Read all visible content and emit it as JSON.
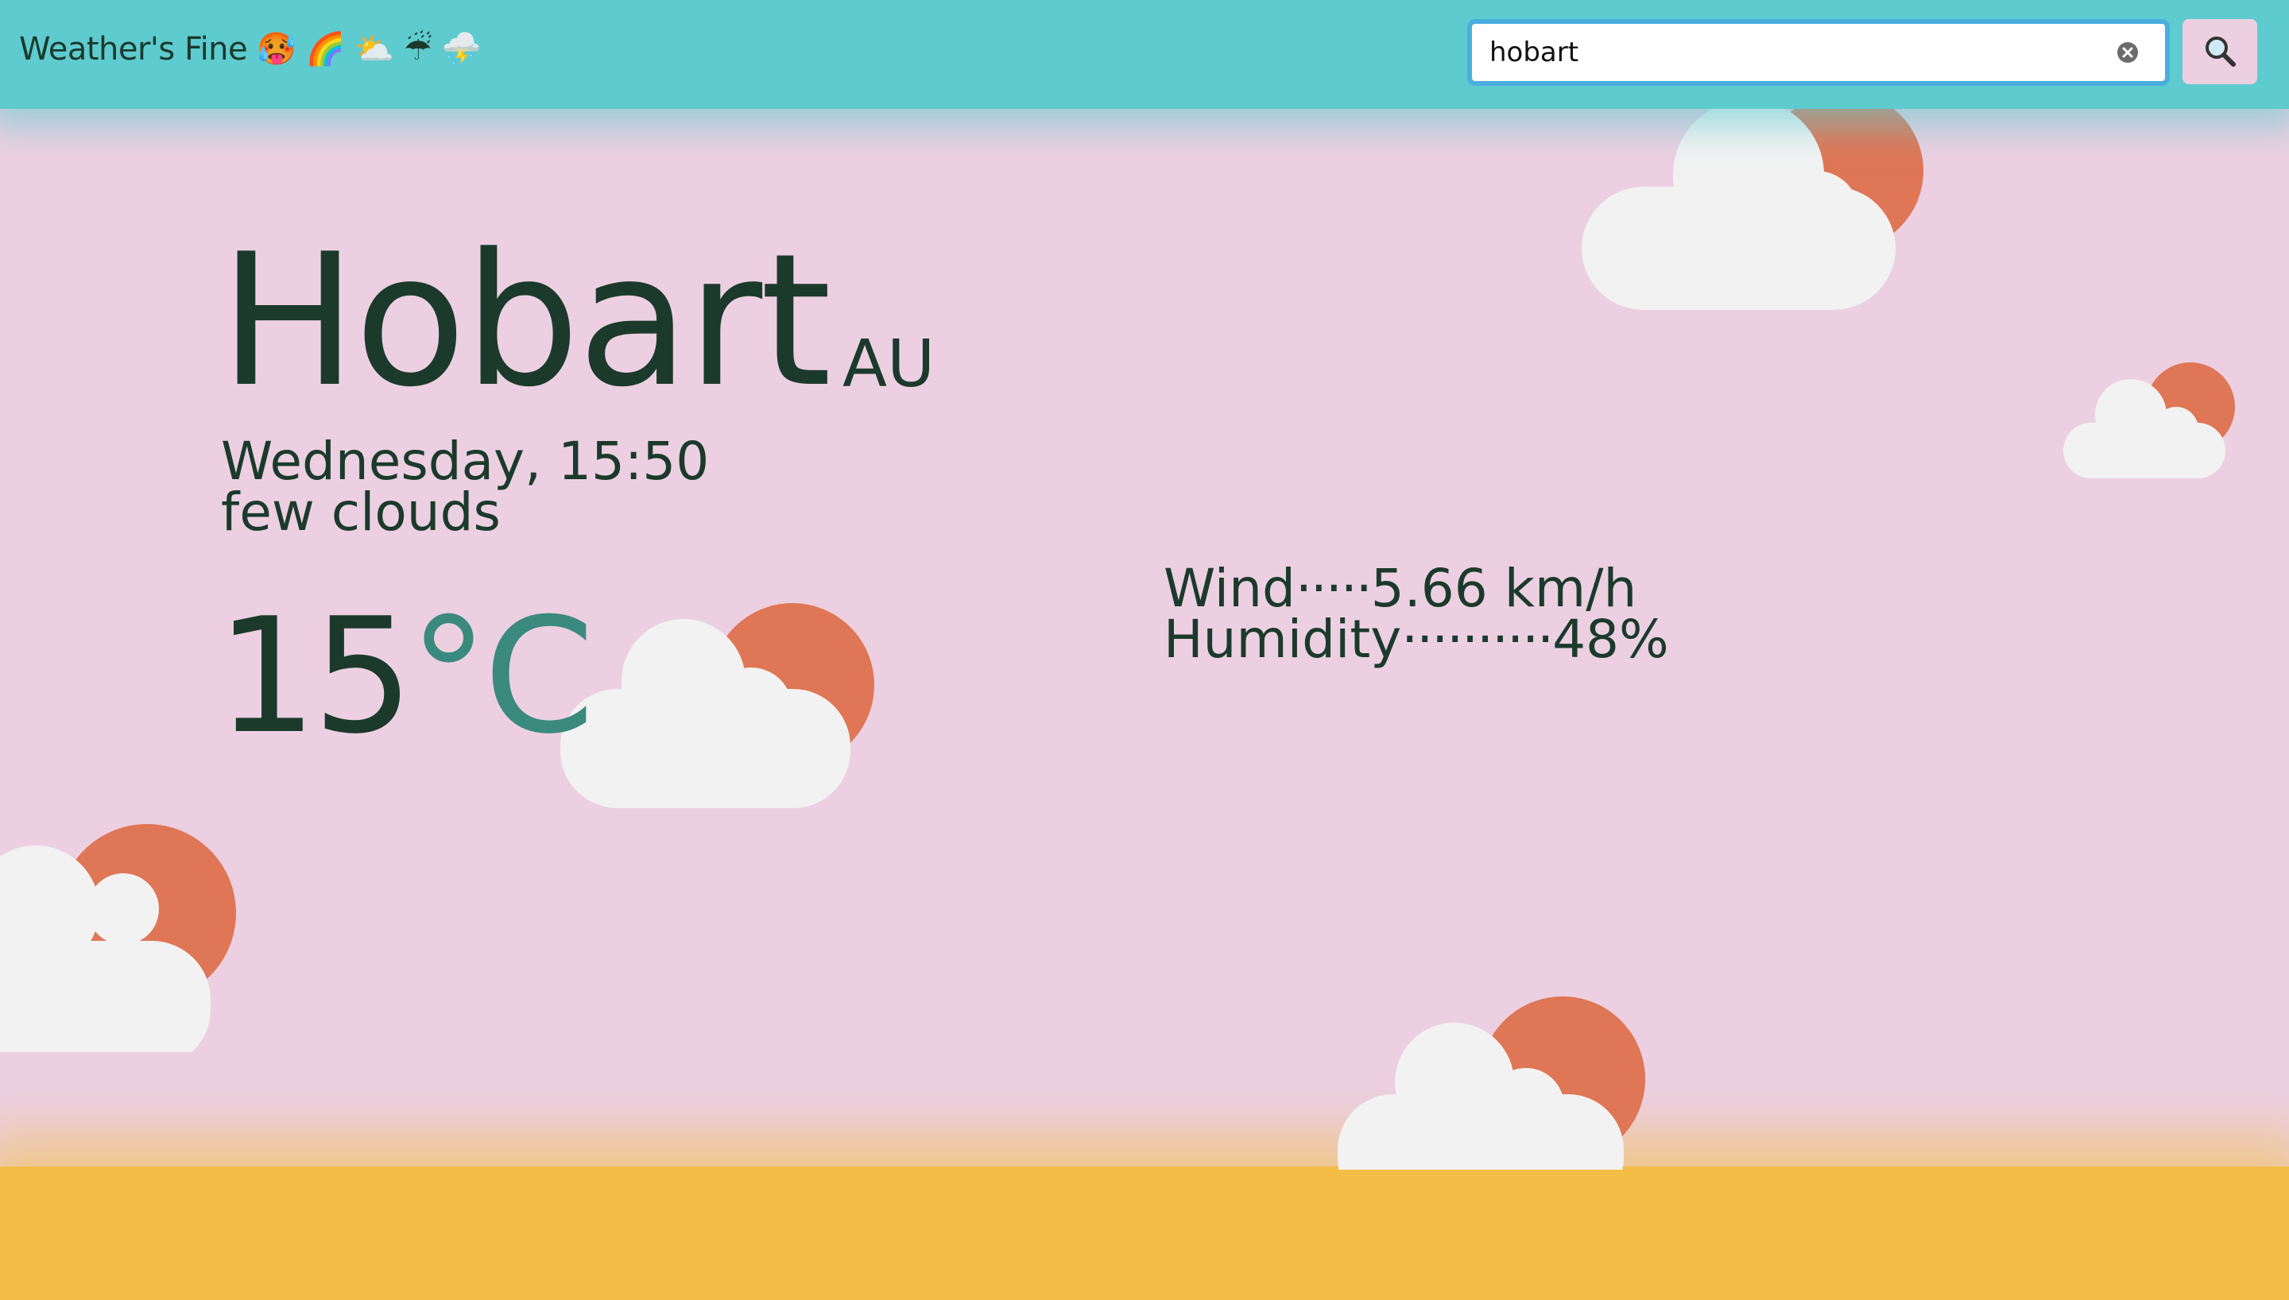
{
  "header": {
    "app_title": "Weather's Fine 🥵 🌈 ⛅ ☔ ⛈️",
    "search": {
      "value": "hobart"
    },
    "search_button_icon": "magnifier-icon"
  },
  "weather": {
    "city": "Hobart",
    "country": "AU",
    "datetime": "Wednesday, 15:50",
    "condition": "few clouds",
    "temperature": "15",
    "unit": "°C",
    "wind_label": "Wind",
    "wind_dots": "·····",
    "wind_value": "5.66 km/h",
    "humidity_label": "Humidity",
    "humidity_dots": "··········",
    "humidity_value": "48%"
  },
  "colors": {
    "header": "#5ecbcf",
    "background": "#ecd0e1",
    "ground": "#f3be45",
    "sun": "#df7655",
    "cloud": "#f2f2f2",
    "text": "#1b3a2c",
    "unit": "#3a8a7e"
  }
}
